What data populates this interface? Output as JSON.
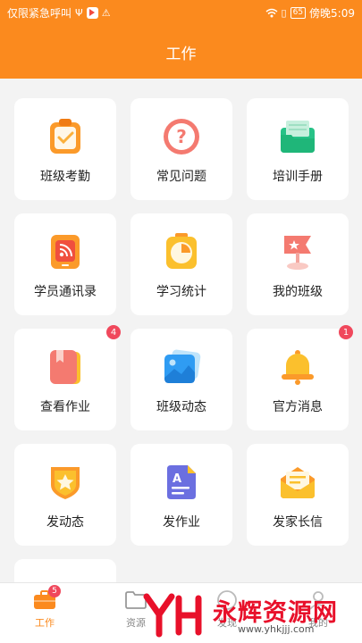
{
  "status_bar": {
    "left_text": "仅限紧急呼叫",
    "battery": "65",
    "time": "傍晚5:09"
  },
  "header": {
    "title": "工作"
  },
  "tiles": [
    {
      "label": "班级考勤",
      "icon": "clipboard-check-icon",
      "badge": null
    },
    {
      "label": "常见问题",
      "icon": "question-icon",
      "badge": null
    },
    {
      "label": "培训手册",
      "icon": "folder-icon",
      "badge": null
    },
    {
      "label": "学员通讯录",
      "icon": "contact-book-icon",
      "badge": null
    },
    {
      "label": "学习统计",
      "icon": "clock-chart-icon",
      "badge": null
    },
    {
      "label": "我的班级",
      "icon": "flag-icon",
      "badge": null
    },
    {
      "label": "查看作业",
      "icon": "book-icon",
      "badge": "4"
    },
    {
      "label": "班级动态",
      "icon": "image-icon",
      "badge": null
    },
    {
      "label": "官方消息",
      "icon": "bell-icon",
      "badge": "1"
    },
    {
      "label": "发动态",
      "icon": "star-badge-icon",
      "badge": null
    },
    {
      "label": "发作业",
      "icon": "document-a-icon",
      "badge": null
    },
    {
      "label": "发家长信",
      "icon": "envelope-icon",
      "badge": null
    }
  ],
  "tabs": [
    {
      "label": "工作",
      "icon": "briefcase-icon",
      "badge": "5",
      "active": true
    },
    {
      "label": "资源",
      "icon": "folder-outline-icon",
      "badge": null,
      "active": false
    },
    {
      "label": "发现",
      "icon": "compass-icon",
      "badge": null,
      "active": false
    },
    {
      "label": "我的",
      "icon": "user-icon",
      "badge": null,
      "active": false
    }
  ],
  "watermark": {
    "brand": "永辉资源网",
    "url": "www.yhkjjj.com"
  },
  "colors": {
    "accent": "#fb8a1e",
    "badge": "#f0485c"
  }
}
